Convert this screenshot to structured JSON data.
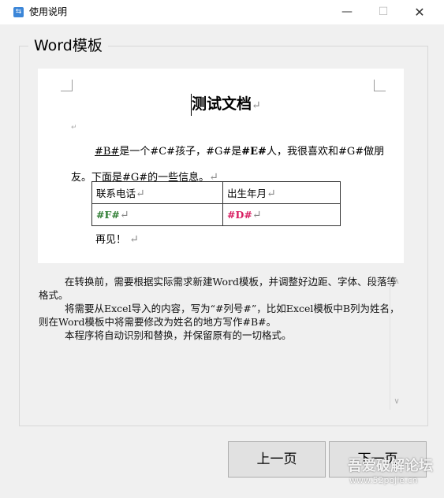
{
  "window": {
    "title": "使用说明",
    "icon": "app-icon",
    "controls": {
      "minimize": "—",
      "maximize": "☐",
      "close": "✕"
    }
  },
  "group": {
    "label": "Word模板"
  },
  "document": {
    "title": "测试文档",
    "para_mark": "↵",
    "paragraph_parts": {
      "p1": "#B#",
      "p2": "是一个#C#孩子，#G#是",
      "p3": "#E#",
      "p4": "人，我很喜欢和#G#做朋友。下面是#G#的一些信息。"
    },
    "table": {
      "headers": [
        "联系电话",
        "出生年月"
      ],
      "values": [
        "#F#",
        "#D#"
      ]
    },
    "closing": "再见！"
  },
  "instructions": {
    "paragraphs": [
      "在转换前，需要根据实际需求新建Word模板，并调整好边距、字体、段落等格式。",
      "将需要从Excel导入的内容，写为“#列号#”，比如Excel模板中B列为姓名，则在Word模板中将需要修改为姓名的地方写作#B#。",
      "本程序将自动识别和替换，并保留原有的一切格式。"
    ]
  },
  "buttons": {
    "prev": "上一页",
    "next": "下一页"
  },
  "watermark": {
    "main": "吾爱破解论坛",
    "sub": "www.52pojie.cn"
  }
}
